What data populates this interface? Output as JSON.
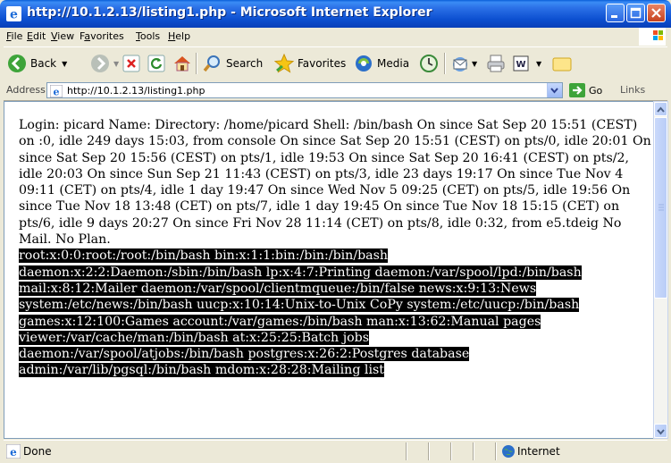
{
  "window": {
    "title": "http://10.1.2.13/listing1.php - Microsoft Internet Explorer",
    "icon": "ie-icon"
  },
  "menu": {
    "items": [
      {
        "label": "File",
        "key": "F"
      },
      {
        "label": "Edit",
        "key": "E"
      },
      {
        "label": "View",
        "key": "V"
      },
      {
        "label": "Favorites",
        "key": "a"
      },
      {
        "label": "Tools",
        "key": "T"
      },
      {
        "label": "Help",
        "key": "H"
      }
    ]
  },
  "toolbar": {
    "back_label": "Back",
    "search_label": "Search",
    "favorites_label": "Favorites",
    "media_label": "Media"
  },
  "address": {
    "label": "Address",
    "url": "http://10.1.2.13/listing1.php",
    "go_label": "Go",
    "links_label": "Links"
  },
  "content": {
    "normal_text": "Login: picard Name: Directory: /home/picard Shell: /bin/bash On since Sat Sep 20 15:51 (CEST) on :0, idle 249 days 15:03, from console On since Sat Sep 20 15:51 (CEST) on pts/0, idle 20:01 On since Sat Sep 20 15:56 (CEST) on pts/1, idle 19:53 On since Sat Sep 20 16:41 (CEST) on pts/2, idle 20:03 On since Sun Sep 21 11:43 (CEST) on pts/3, idle 23 days 19:17 On since Tue Nov 4 09:11 (CET) on pts/4, idle 1 day 19:47 On since Wed Nov 5 09:25 (CET) on pts/5, idle 19:56 On since Tue Nov 18 13:48 (CET) on pts/7, idle 1 day 19:45 On since Tue Nov 18 15:15 (CET) on pts/6, idle 9 days 20:27 On since Fri Nov 28 11:14 (CET) on pts/8, idle 0:32, from e5.tdeig No Mail. No Plan.",
    "highlighted_lines": [
      "root:x:0:0:root:/root:/bin/bash bin:x:1:1:bin:/bin:/bin/bash",
      "daemon:x:2:2:Daemon:/sbin:/bin/bash lp:x:4:7:Printing daemon:/var/spool/lpd:/bin/bash",
      "mail:x:8:12:Mailer daemon:/var/spool/clientmqueue:/bin/false news:x:9:13:News",
      "system:/etc/news:/bin/bash uucp:x:10:14:Unix-to-Unix CoPy system:/etc/uucp:/bin/bash",
      "games:x:12:100:Games account:/var/games:/bin/bash man:x:13:62:Manual pages",
      "viewer:/var/cache/man:/bin/bash at:x:25:25:Batch jobs",
      "daemon:/var/spool/atjobs:/bin/bash postgres:x:26:2:Postgres database",
      "admin:/var/lib/pgsql:/bin/bash mdom:x:28:28:Mailing list"
    ]
  },
  "status": {
    "text": "Done",
    "zone": "Internet"
  }
}
